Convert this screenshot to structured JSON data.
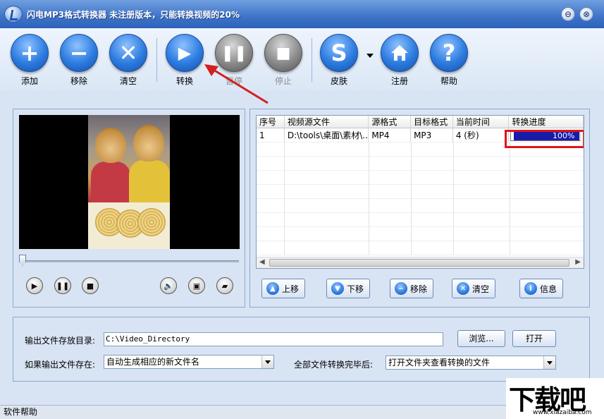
{
  "window": {
    "title": "闪电MP3格式转换器  未注册版本，只能转换视频的20%",
    "controls": {
      "minimize": "⊖",
      "close": "⊗"
    }
  },
  "toolbar": {
    "add": "添加",
    "remove": "移除",
    "clear": "清空",
    "convert": "转换",
    "pause": "暂停",
    "stop": "停止",
    "skin": "皮肤",
    "register": "注册",
    "help": "帮助"
  },
  "table": {
    "columns": [
      "序号",
      "视频源文件",
      "源格式",
      "目标格式",
      "当前时间",
      "转换进度"
    ],
    "rows": [
      {
        "index": "1",
        "source": "D:\\tools\\桌面\\素材\\...",
        "src_format": "MP4",
        "dst_format": "MP3",
        "time": "4 (秒)",
        "progress_text": "100%",
        "progress": 1.0
      }
    ]
  },
  "list_buttons": {
    "up": "上移",
    "down": "下移",
    "remove": "移除",
    "clear": "清空",
    "info": "信息"
  },
  "settings": {
    "output_dir_label": "输出文件存放目录:",
    "output_dir_value": "C:\\Video_Directory",
    "browse": "浏览...",
    "open": "打开",
    "exists_label": "如果输出文件存在:",
    "exists_value": "自动生成相应的新文件名",
    "after_label": "全部文件转换完毕后:",
    "after_value": "打开文件夹查看转换的文件"
  },
  "status": {
    "text": "软件帮助"
  },
  "watermark": {
    "big": "下载吧",
    "small": "www.xiazaiba.com"
  },
  "colors": {
    "accent_blue": "#2c7be0",
    "progress_fill": "#1a1aa8",
    "highlight_red": "#e01616",
    "arrow_red": "#d32020"
  }
}
